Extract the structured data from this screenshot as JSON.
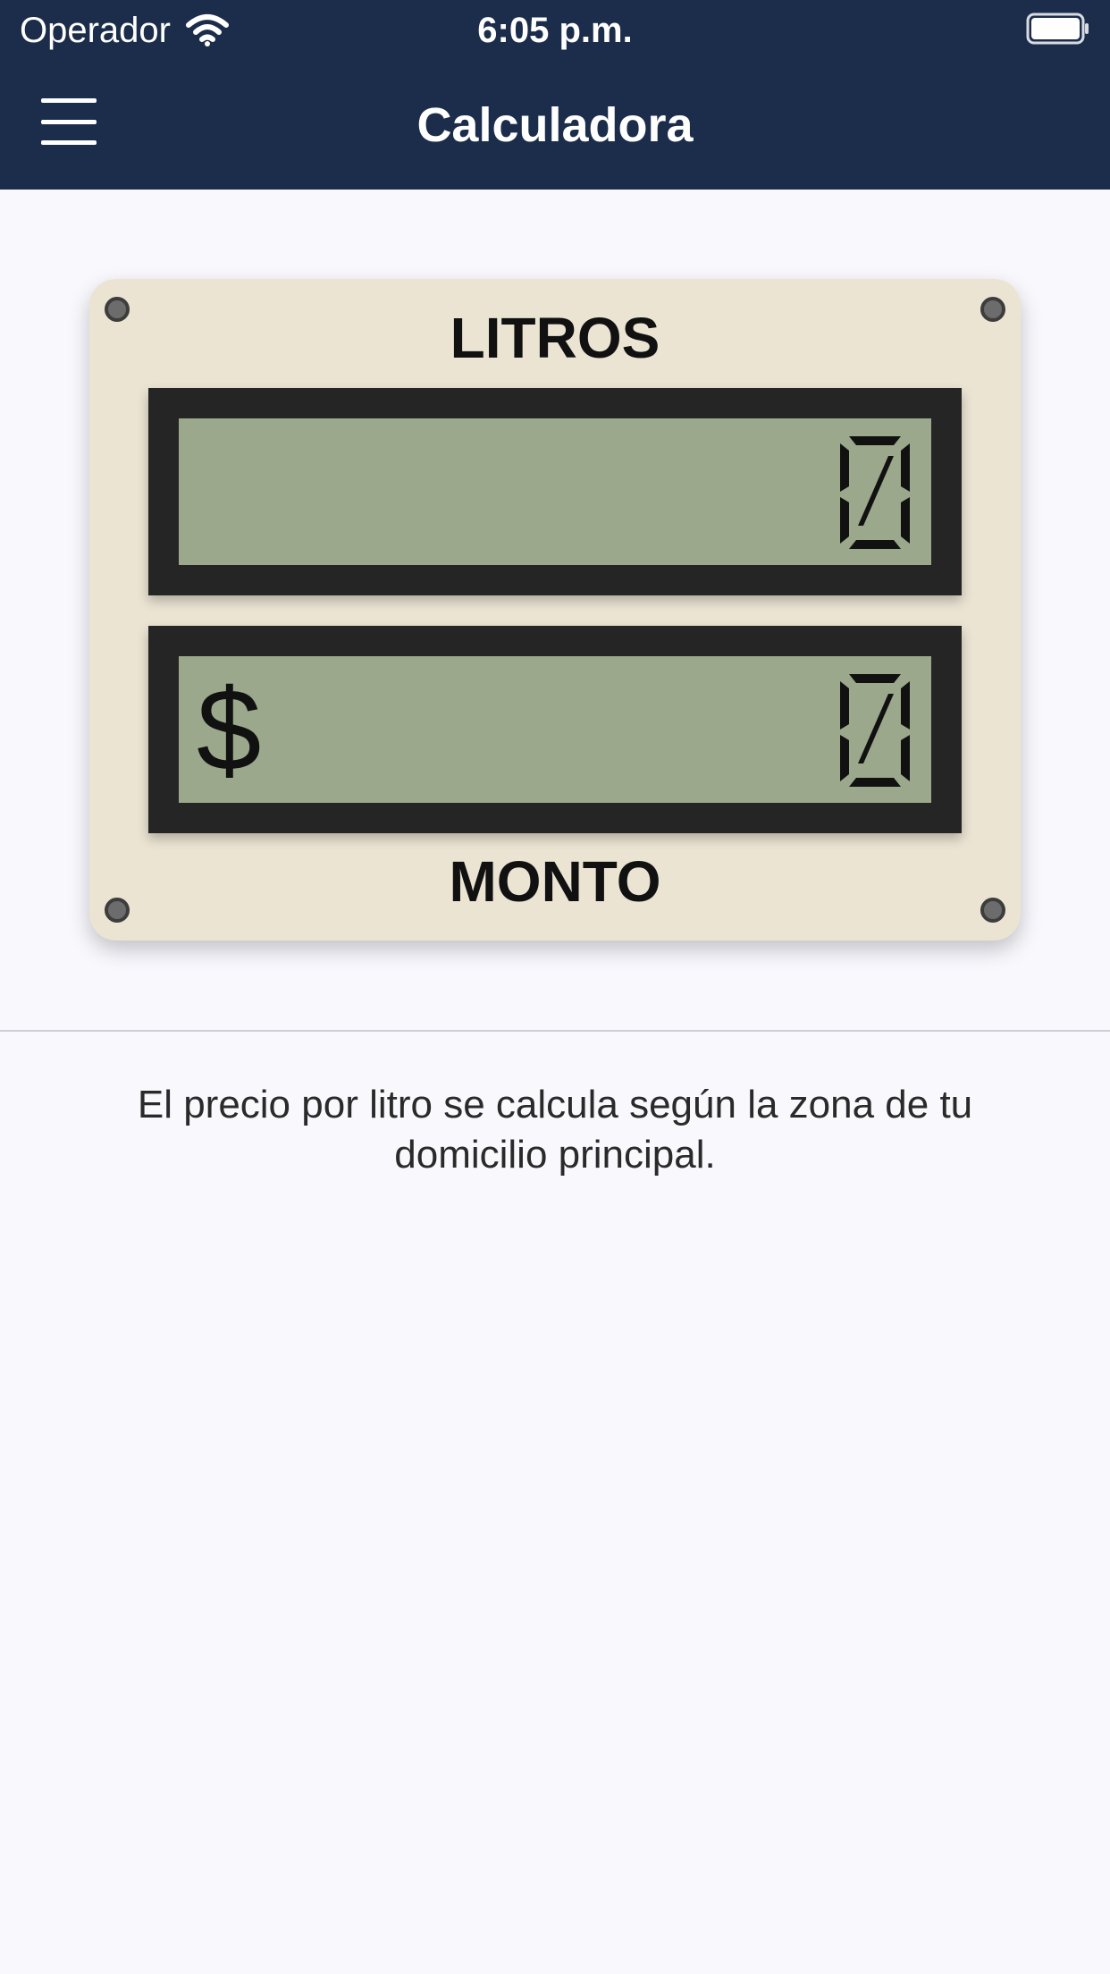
{
  "status_bar": {
    "carrier": "Operador",
    "time": "6:05 p.m.",
    "icons": [
      "wifi-icon",
      "battery-icon"
    ]
  },
  "header": {
    "title": "Calculadora",
    "menu_icon": "hamburger-menu-icon",
    "background_color": "#1b2d4b"
  },
  "panel": {
    "top_label": "LITROS",
    "bottom_label": "MONTO",
    "litros_value": "0",
    "monto_currency": "$",
    "monto_value": "0",
    "lcd_color": "#9ba88b",
    "panel_color": "#ebe4d3"
  },
  "info": {
    "text": "El precio por litro se calcula según la zona de tu domicilio principal."
  }
}
